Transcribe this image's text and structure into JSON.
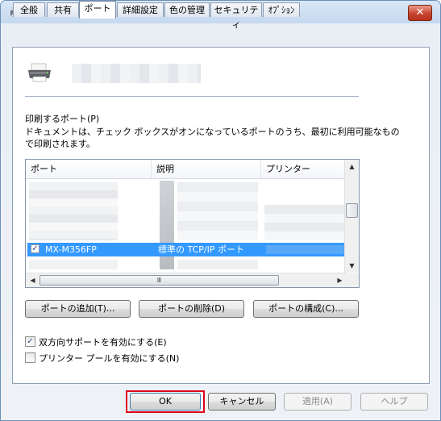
{
  "tabs": [
    "全般",
    "共有",
    "ポート",
    "詳細設定",
    "色の管理",
    "セキュリティ",
    "ｵﾌﾟｼｮﾝ"
  ],
  "active_tab": "ポート",
  "close_glyph": "✕",
  "port_section": {
    "heading": "印刷するポート(P)",
    "description_line1": "ドキュメントは、チェック ボックスがオンになっているポートのうち、最初に利用可能なもの",
    "description_line2": "で印刷されます。"
  },
  "port_list": {
    "columns": [
      "ポート",
      "説明",
      "プリンター"
    ],
    "selected_row": {
      "checked": true,
      "port": "MX-M356FP",
      "description": "標準の TCP/IP ポート"
    },
    "hscroll_grip": "Ⅲ"
  },
  "port_buttons": {
    "add": "ポートの追加(T)...",
    "delete": "ポートの削除(D)",
    "configure": "ポートの構成(C)..."
  },
  "options": {
    "bidirectional": {
      "label": "双方向サポートを有効にする(E)",
      "checked": true
    },
    "pooling": {
      "label": "プリンター プールを有効にする(N)",
      "checked": false
    }
  },
  "footer": {
    "ok": "OK",
    "cancel": "キャンセル",
    "apply": "適用(A)",
    "help": "ヘルプ"
  },
  "colors": {
    "selection": "#3399ff",
    "highlight_box": "#e0001b"
  }
}
